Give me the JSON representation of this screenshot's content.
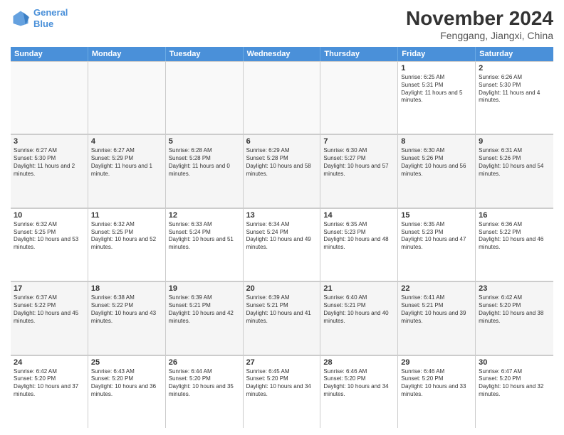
{
  "logo": {
    "line1": "General",
    "line2": "Blue"
  },
  "title": "November 2024",
  "subtitle": "Fenggang, Jiangxi, China",
  "days": [
    "Sunday",
    "Monday",
    "Tuesday",
    "Wednesday",
    "Thursday",
    "Friday",
    "Saturday"
  ],
  "weeks": [
    [
      {
        "day": "",
        "text": ""
      },
      {
        "day": "",
        "text": ""
      },
      {
        "day": "",
        "text": ""
      },
      {
        "day": "",
        "text": ""
      },
      {
        "day": "",
        "text": ""
      },
      {
        "day": "1",
        "text": "Sunrise: 6:25 AM\nSunset: 5:31 PM\nDaylight: 11 hours and 5 minutes."
      },
      {
        "day": "2",
        "text": "Sunrise: 6:26 AM\nSunset: 5:30 PM\nDaylight: 11 hours and 4 minutes."
      }
    ],
    [
      {
        "day": "3",
        "text": "Sunrise: 6:27 AM\nSunset: 5:30 PM\nDaylight: 11 hours and 2 minutes."
      },
      {
        "day": "4",
        "text": "Sunrise: 6:27 AM\nSunset: 5:29 PM\nDaylight: 11 hours and 1 minute."
      },
      {
        "day": "5",
        "text": "Sunrise: 6:28 AM\nSunset: 5:28 PM\nDaylight: 11 hours and 0 minutes."
      },
      {
        "day": "6",
        "text": "Sunrise: 6:29 AM\nSunset: 5:28 PM\nDaylight: 10 hours and 58 minutes."
      },
      {
        "day": "7",
        "text": "Sunrise: 6:30 AM\nSunset: 5:27 PM\nDaylight: 10 hours and 57 minutes."
      },
      {
        "day": "8",
        "text": "Sunrise: 6:30 AM\nSunset: 5:26 PM\nDaylight: 10 hours and 56 minutes."
      },
      {
        "day": "9",
        "text": "Sunrise: 6:31 AM\nSunset: 5:26 PM\nDaylight: 10 hours and 54 minutes."
      }
    ],
    [
      {
        "day": "10",
        "text": "Sunrise: 6:32 AM\nSunset: 5:25 PM\nDaylight: 10 hours and 53 minutes."
      },
      {
        "day": "11",
        "text": "Sunrise: 6:32 AM\nSunset: 5:25 PM\nDaylight: 10 hours and 52 minutes."
      },
      {
        "day": "12",
        "text": "Sunrise: 6:33 AM\nSunset: 5:24 PM\nDaylight: 10 hours and 51 minutes."
      },
      {
        "day": "13",
        "text": "Sunrise: 6:34 AM\nSunset: 5:24 PM\nDaylight: 10 hours and 49 minutes."
      },
      {
        "day": "14",
        "text": "Sunrise: 6:35 AM\nSunset: 5:23 PM\nDaylight: 10 hours and 48 minutes."
      },
      {
        "day": "15",
        "text": "Sunrise: 6:35 AM\nSunset: 5:23 PM\nDaylight: 10 hours and 47 minutes."
      },
      {
        "day": "16",
        "text": "Sunrise: 6:36 AM\nSunset: 5:22 PM\nDaylight: 10 hours and 46 minutes."
      }
    ],
    [
      {
        "day": "17",
        "text": "Sunrise: 6:37 AM\nSunset: 5:22 PM\nDaylight: 10 hours and 45 minutes."
      },
      {
        "day": "18",
        "text": "Sunrise: 6:38 AM\nSunset: 5:22 PM\nDaylight: 10 hours and 43 minutes."
      },
      {
        "day": "19",
        "text": "Sunrise: 6:39 AM\nSunset: 5:21 PM\nDaylight: 10 hours and 42 minutes."
      },
      {
        "day": "20",
        "text": "Sunrise: 6:39 AM\nSunset: 5:21 PM\nDaylight: 10 hours and 41 minutes."
      },
      {
        "day": "21",
        "text": "Sunrise: 6:40 AM\nSunset: 5:21 PM\nDaylight: 10 hours and 40 minutes."
      },
      {
        "day": "22",
        "text": "Sunrise: 6:41 AM\nSunset: 5:21 PM\nDaylight: 10 hours and 39 minutes."
      },
      {
        "day": "23",
        "text": "Sunrise: 6:42 AM\nSunset: 5:20 PM\nDaylight: 10 hours and 38 minutes."
      }
    ],
    [
      {
        "day": "24",
        "text": "Sunrise: 6:42 AM\nSunset: 5:20 PM\nDaylight: 10 hours and 37 minutes."
      },
      {
        "day": "25",
        "text": "Sunrise: 6:43 AM\nSunset: 5:20 PM\nDaylight: 10 hours and 36 minutes."
      },
      {
        "day": "26",
        "text": "Sunrise: 6:44 AM\nSunset: 5:20 PM\nDaylight: 10 hours and 35 minutes."
      },
      {
        "day": "27",
        "text": "Sunrise: 6:45 AM\nSunset: 5:20 PM\nDaylight: 10 hours and 34 minutes."
      },
      {
        "day": "28",
        "text": "Sunrise: 6:46 AM\nSunset: 5:20 PM\nDaylight: 10 hours and 34 minutes."
      },
      {
        "day": "29",
        "text": "Sunrise: 6:46 AM\nSunset: 5:20 PM\nDaylight: 10 hours and 33 minutes."
      },
      {
        "day": "30",
        "text": "Sunrise: 6:47 AM\nSunset: 5:20 PM\nDaylight: 10 hours and 32 minutes."
      }
    ]
  ]
}
